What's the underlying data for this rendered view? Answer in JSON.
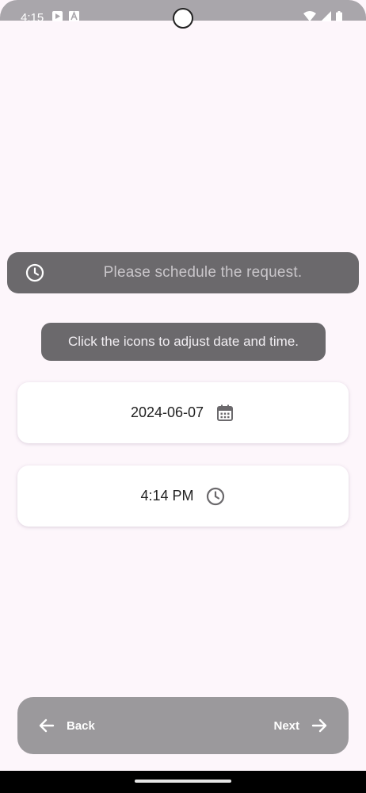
{
  "status_bar": {
    "time": "4:15",
    "left_icons": [
      "play-icon",
      "a-icon"
    ],
    "right_icons": [
      "wifi-icon",
      "signal-icon",
      "battery-icon"
    ]
  },
  "banner": {
    "icon": "clock-icon",
    "text": "Please schedule the request."
  },
  "hint": {
    "text": "Click the icons to adjust date and time."
  },
  "date_card": {
    "value": "2024-06-07",
    "icon": "calendar-icon"
  },
  "time_card": {
    "value": "4:14 PM",
    "icon": "clock-icon"
  },
  "navigation": {
    "back_label": "Back",
    "next_label": "Next"
  },
  "colors": {
    "background": "#fdf6fb",
    "banner": "#6b696c",
    "nav_bar": "#9b999c",
    "card": "#ffffff"
  }
}
